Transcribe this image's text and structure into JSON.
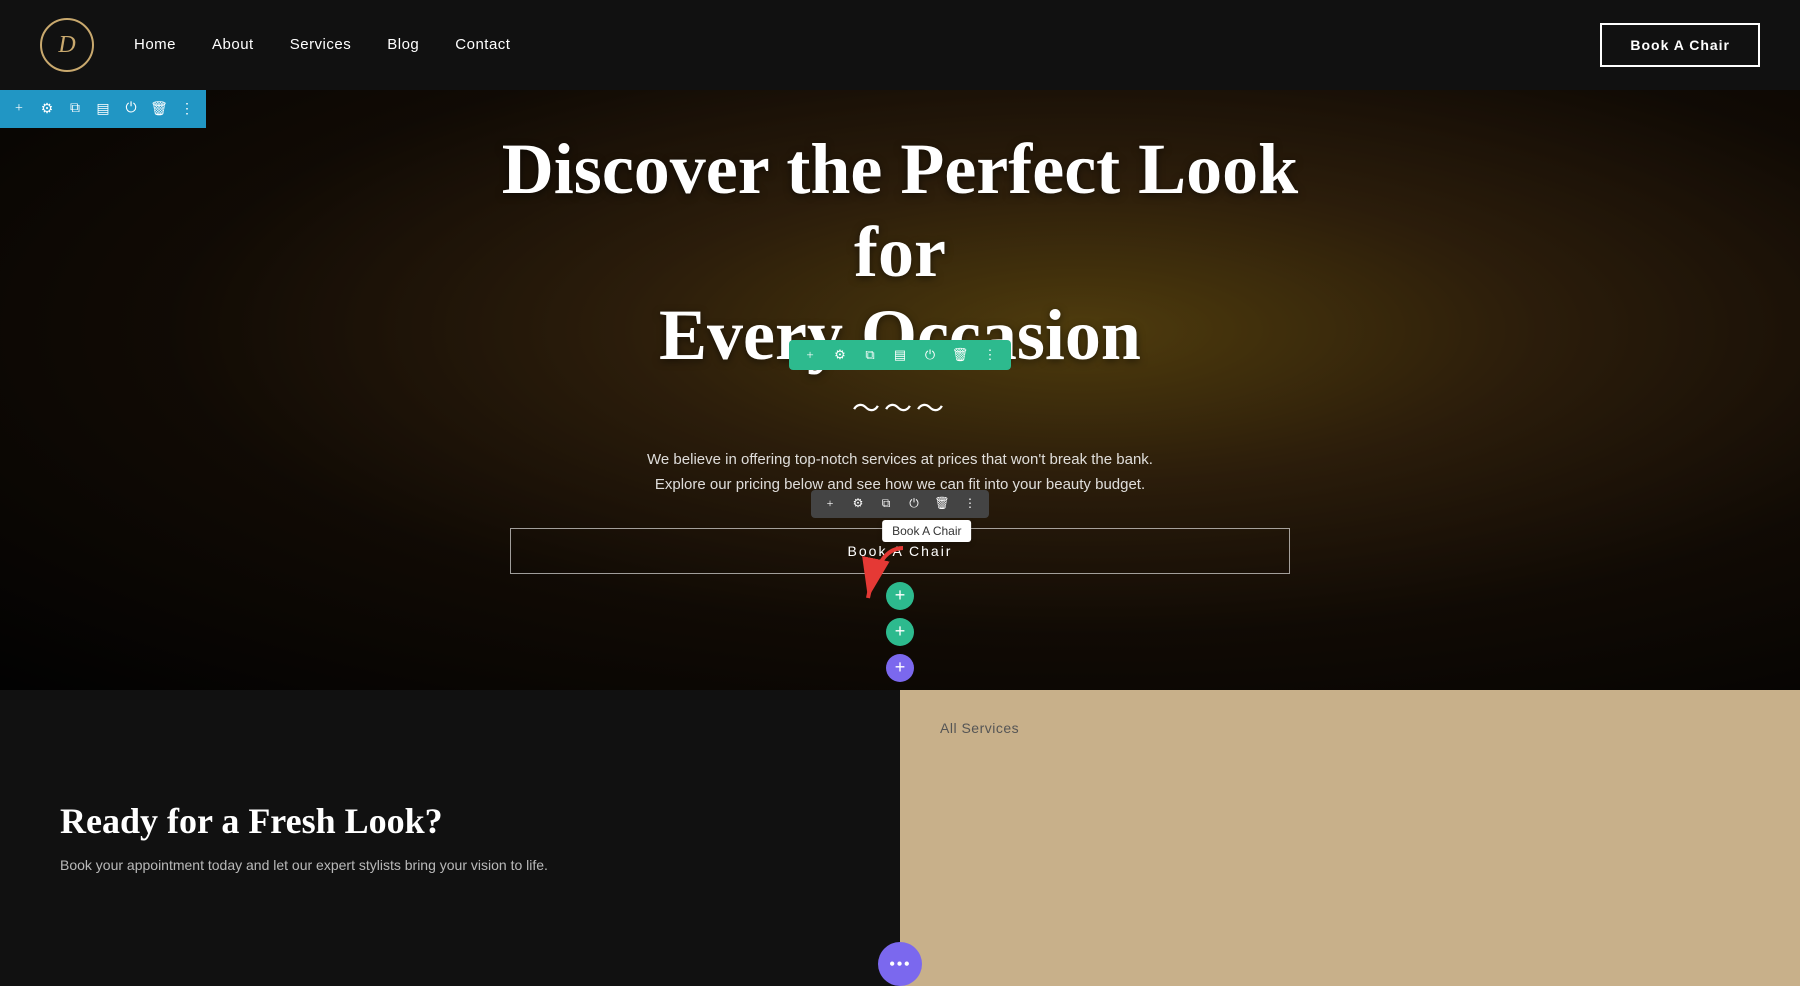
{
  "navbar": {
    "logo_letter": "D",
    "nav_items": [
      "Home",
      "About",
      "Services",
      "Blog",
      "Contact"
    ],
    "cta_label": "Book A Chair"
  },
  "top_toolbar": {
    "icons": [
      "+",
      "⚙",
      "⧉",
      "▤",
      "⏻",
      "🗑",
      "⋮"
    ]
  },
  "hero": {
    "floating_toolbar_icons": [
      "+",
      "⚙",
      "⧉",
      "▤",
      "⏻",
      "🗑",
      "⋮"
    ],
    "title_line1": "Discover the Perfect Look for",
    "title_line2": "Every Occasion",
    "squiggle": "〜〜〜",
    "subtitle": "We believe in offering top-notch services at prices that won't break the bank. Explore our pricing below and see how we can fit into your beauty budget.",
    "button_toolbar_icons": [
      "+",
      "⚙",
      "⧉",
      "⏻",
      "🗑",
      "⋮"
    ],
    "book_btn_label": "Book A Chair",
    "tooltip_label": "Book A Chair",
    "add_btn_1": "+",
    "add_btn_2": "+",
    "add_btn_3": "+"
  },
  "bottom": {
    "left": {
      "heading": "Ready for a Fresh Look?",
      "text": "Book your appointment today and let our expert stylists bring your vision to life."
    },
    "right": {
      "label": "All Services"
    },
    "purple_dot": "•••"
  }
}
